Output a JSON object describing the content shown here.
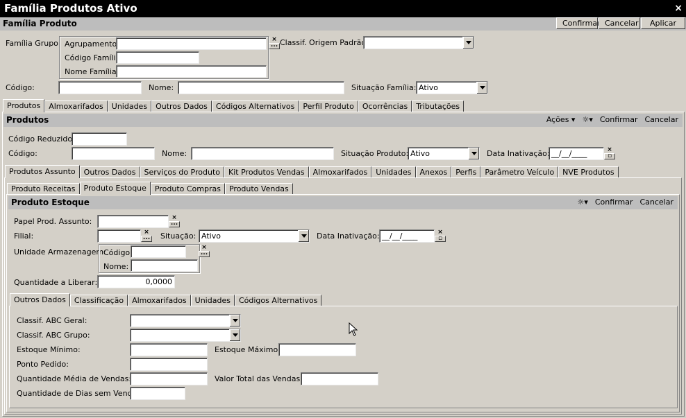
{
  "window": {
    "title": "Família Produtos Ativo",
    "close": "×"
  },
  "familia_bar": {
    "title": "Família Produto",
    "confirm": "Confirmar",
    "cancel": "Cancelar",
    "apply": "Aplicar"
  },
  "familia": {
    "grupo_label": "Família Grupo:",
    "agrupamento_label": "Agrupamento:",
    "codigo_familia_label": "Código Família",
    "nome_familia_label": "Nome Família:",
    "classif_origem_label": "Classif. Origem Padrão:",
    "codigo_label": "Código:",
    "nome_label": "Nome:",
    "situacao_label": "Situação Família:",
    "situacao_value": "Ativo"
  },
  "tabs1": [
    "Produtos",
    "Almoxarifados",
    "Unidades",
    "Outros Dados",
    "Códigos Alternativos",
    "Perfil Produto",
    "Ocorrências",
    "Tributações"
  ],
  "produtos_bar": {
    "title": "Produtos",
    "actions": "Ações",
    "confirm": "Confirmar",
    "cancel": "Cancelar"
  },
  "produtos": {
    "codigo_reduzido_label": "Código Reduzido:",
    "codigo_label": "Código:",
    "nome_label": "Nome:",
    "situacao_label": "Situação Produto:",
    "situacao_value": "Ativo",
    "data_inativacao_label": "Data Inativação:",
    "data_inativacao_value": "__/__/____"
  },
  "tabs2": [
    "Produtos Assunto",
    "Outros Dados",
    "Serviços do Produto",
    "Kit Produtos Vendas",
    "Almoxarifados",
    "Unidades",
    "Anexos",
    "Perfis",
    "Parâmetro Veículo",
    "NVE Produtos"
  ],
  "tabs3": [
    "Produto Receitas",
    "Produto Estoque",
    "Produto Compras",
    "Produto Vendas"
  ],
  "estoque_bar": {
    "title": "Produto Estoque",
    "confirm": "Confirmar",
    "cancel": "Cancelar"
  },
  "estoque": {
    "papel_label": "Papel Prod. Assunto:",
    "filial_label": "Filial:",
    "situacao_label": "Situação:",
    "situacao_value": "Ativo",
    "data_inativacao_label": "Data Inativação:",
    "data_inativacao_value": "__/__/____",
    "unidade_label": "Unidade Armazenagem:",
    "codigo_label": "Código:",
    "nome_label": "Nome:",
    "quantidade_label": "Quantidade a Liberar:",
    "quantidade_value": "0,0000"
  },
  "tabs4": [
    "Outros Dados",
    "Classificação",
    "Almoxarifados",
    "Unidades",
    "Códigos Alternativos"
  ],
  "outros": {
    "abc_geral_label": "Classif. ABC Geral:",
    "abc_grupo_label": "Classif. ABC Grupo:",
    "estoque_min_label": "Estoque Mínimo:",
    "estoque_max_label": "Estoque Máximo:",
    "ponto_pedido_label": "Ponto Pedido:",
    "qtd_media_label": "Quantidade Média de Vendas:",
    "valor_total_label": "Valor Total das Vendas:",
    "qtd_dias_label": "Quantidade de Dias sem Vender:"
  }
}
